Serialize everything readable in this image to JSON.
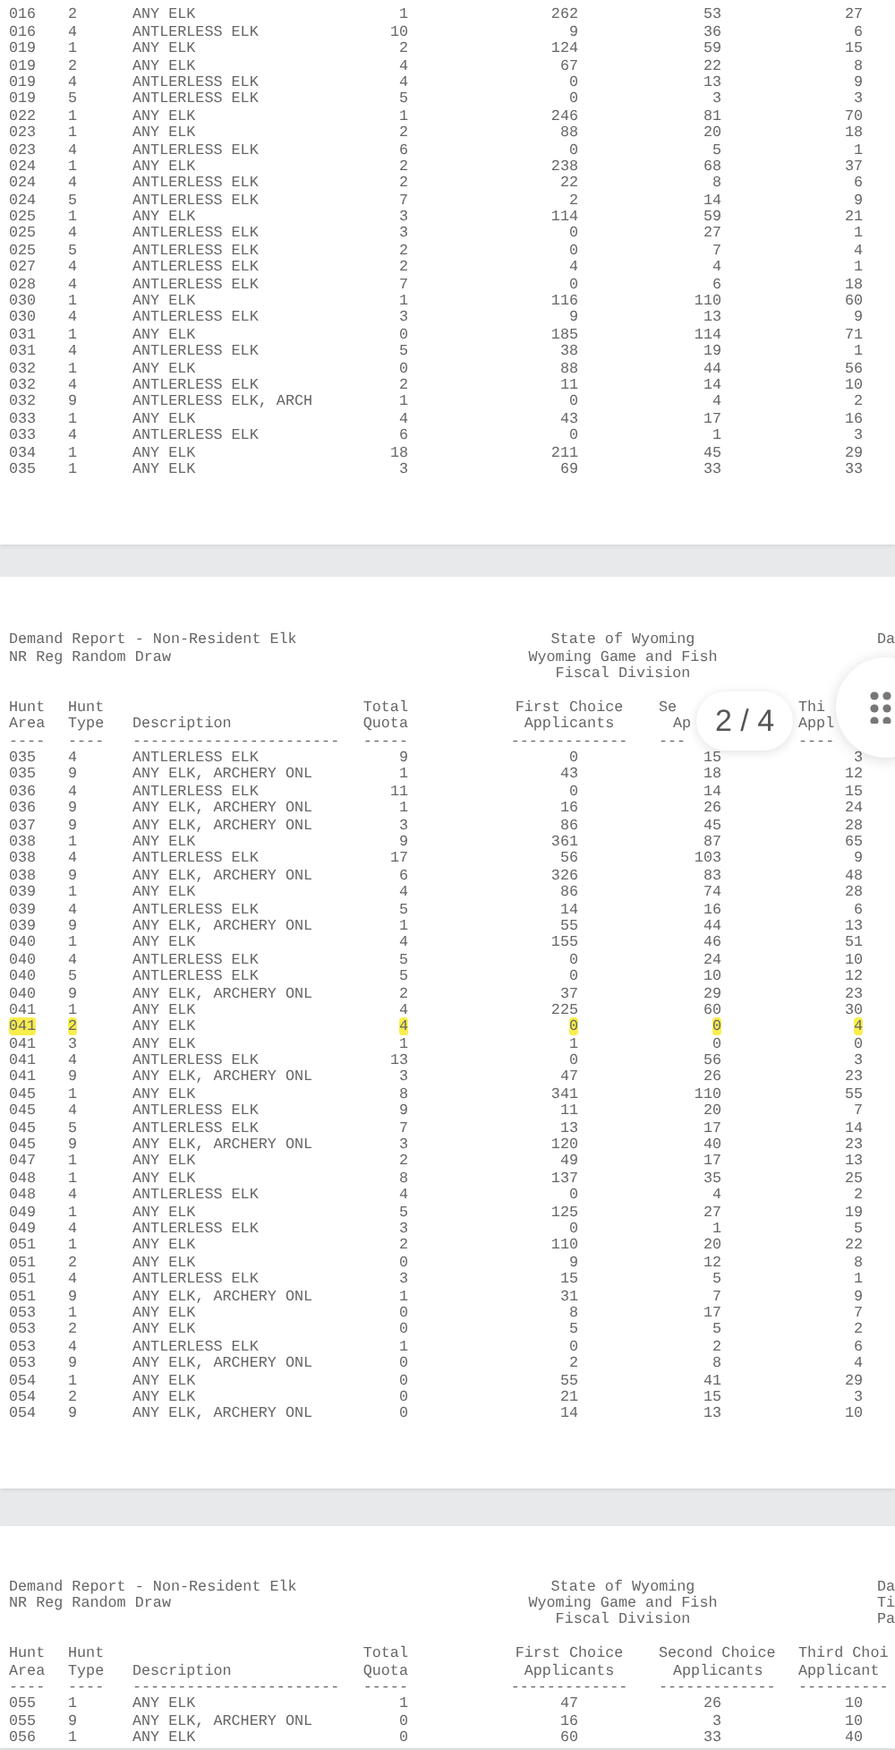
{
  "pages": [
    {
      "rows": [
        {
          "cells": [
            "016",
            "2",
            "ANY ELK",
            "1",
            "262",
            "53",
            "27"
          ],
          "highlighted": false
        },
        {
          "cells": [
            "016",
            "4",
            "ANTLERLESS ELK",
            "10",
            "9",
            "36",
            "6"
          ],
          "highlighted": false
        },
        {
          "cells": [
            "019",
            "1",
            "ANY ELK",
            "2",
            "124",
            "59",
            "15"
          ],
          "highlighted": false
        },
        {
          "cells": [
            "019",
            "2",
            "ANY ELK",
            "4",
            "67",
            "22",
            "8"
          ],
          "highlighted": false
        },
        {
          "cells": [
            "019",
            "4",
            "ANTLERLESS ELK",
            "4",
            "0",
            "13",
            "9"
          ],
          "highlighted": false
        },
        {
          "cells": [
            "019",
            "5",
            "ANTLERLESS ELK",
            "5",
            "0",
            "3",
            "3"
          ],
          "highlighted": false
        },
        {
          "cells": [
            "022",
            "1",
            "ANY ELK",
            "1",
            "246",
            "81",
            "70"
          ],
          "highlighted": false
        },
        {
          "cells": [
            "023",
            "1",
            "ANY ELK",
            "2",
            "88",
            "20",
            "18"
          ],
          "highlighted": false
        },
        {
          "cells": [
            "023",
            "4",
            "ANTLERLESS ELK",
            "6",
            "0",
            "5",
            "1"
          ],
          "highlighted": false
        },
        {
          "cells": [
            "024",
            "1",
            "ANY ELK",
            "2",
            "238",
            "68",
            "37"
          ],
          "highlighted": false
        },
        {
          "cells": [
            "024",
            "4",
            "ANTLERLESS ELK",
            "2",
            "22",
            "8",
            "6"
          ],
          "highlighted": false
        },
        {
          "cells": [
            "024",
            "5",
            "ANTLERLESS ELK",
            "7",
            "2",
            "14",
            "9"
          ],
          "highlighted": false
        },
        {
          "cells": [
            "025",
            "1",
            "ANY ELK",
            "3",
            "114",
            "59",
            "21"
          ],
          "highlighted": false
        },
        {
          "cells": [
            "025",
            "4",
            "ANTLERLESS ELK",
            "3",
            "0",
            "27",
            "1"
          ],
          "highlighted": false
        },
        {
          "cells": [
            "025",
            "5",
            "ANTLERLESS ELK",
            "2",
            "0",
            "7",
            "4"
          ],
          "highlighted": false
        },
        {
          "cells": [
            "027",
            "4",
            "ANTLERLESS ELK",
            "2",
            "4",
            "4",
            "1"
          ],
          "highlighted": false
        },
        {
          "cells": [
            "028",
            "4",
            "ANTLERLESS ELK",
            "7",
            "0",
            "6",
            "18"
          ],
          "highlighted": false
        },
        {
          "cells": [
            "030",
            "1",
            "ANY ELK",
            "1",
            "116",
            "110",
            "60"
          ],
          "highlighted": false
        },
        {
          "cells": [
            "030",
            "4",
            "ANTLERLESS ELK",
            "3",
            "9",
            "13",
            "9"
          ],
          "highlighted": false
        },
        {
          "cells": [
            "031",
            "1",
            "ANY ELK",
            "0",
            "185",
            "114",
            "71"
          ],
          "highlighted": false
        },
        {
          "cells": [
            "031",
            "4",
            "ANTLERLESS ELK",
            "5",
            "38",
            "19",
            "1"
          ],
          "highlighted": false
        },
        {
          "cells": [
            "032",
            "1",
            "ANY ELK",
            "0",
            "88",
            "44",
            "56"
          ],
          "highlighted": false
        },
        {
          "cells": [
            "032",
            "4",
            "ANTLERLESS ELK",
            "2",
            "11",
            "14",
            "10"
          ],
          "highlighted": false
        },
        {
          "cells": [
            "032",
            "9",
            "ANTLERLESS ELK, ARCH",
            "1",
            "0",
            "4",
            "2"
          ],
          "highlighted": false
        },
        {
          "cells": [
            "033",
            "1",
            "ANY ELK",
            "4",
            "43",
            "17",
            "16"
          ],
          "highlighted": false
        },
        {
          "cells": [
            "033",
            "4",
            "ANTLERLESS ELK",
            "6",
            "0",
            "1",
            "3"
          ],
          "highlighted": false
        },
        {
          "cells": [
            "034",
            "1",
            "ANY ELK",
            "18",
            "211",
            "45",
            "29"
          ],
          "highlighted": false
        },
        {
          "cells": [
            "035",
            "1",
            "ANY ELK",
            "3",
            "69",
            "33",
            "33"
          ],
          "highlighted": false
        }
      ]
    },
    {
      "header": {
        "left": [
          "Demand Report - Non-Resident Elk",
          "NR Reg Random Draw"
        ],
        "center": [
          "State of Wyoming",
          "Wyoming Game and Fish",
          "Fiscal Division"
        ],
        "right": [
          "Da"
        ]
      },
      "columns": [
        {
          "line1": "Hunt",
          "line2": "Area",
          "rule": "----"
        },
        {
          "line1": "Hunt",
          "line2": "Type",
          "rule": "----"
        },
        {
          "line2": "Description",
          "rule": "-----------------------"
        },
        {
          "line1": "Total",
          "line2": "Quota",
          "rule": "-----"
        },
        {
          "line1": "First Choice",
          "line2": "Applicants",
          "rule": "-------------"
        },
        {
          "line1": "Se",
          "line2": "Ap",
          "rule": "---"
        },
        {
          "line1": "Thi",
          "line2": "Appl",
          "rule": "----"
        }
      ],
      "rows": [
        {
          "cells": [
            "035",
            "4",
            "ANTLERLESS ELK",
            "9",
            "0",
            "15",
            "3"
          ],
          "highlighted": false
        },
        {
          "cells": [
            "035",
            "9",
            "ANY ELK, ARCHERY ONL",
            "1",
            "43",
            "18",
            "12"
          ],
          "highlighted": false
        },
        {
          "cells": [
            "036",
            "4",
            "ANTLERLESS ELK",
            "11",
            "0",
            "14",
            "15"
          ],
          "highlighted": false
        },
        {
          "cells": [
            "036",
            "9",
            "ANY ELK, ARCHERY ONL",
            "1",
            "16",
            "26",
            "24"
          ],
          "highlighted": false
        },
        {
          "cells": [
            "037",
            "9",
            "ANY ELK, ARCHERY ONL",
            "3",
            "86",
            "45",
            "28"
          ],
          "highlighted": false
        },
        {
          "cells": [
            "038",
            "1",
            "ANY ELK",
            "9",
            "361",
            "87",
            "65"
          ],
          "highlighted": false
        },
        {
          "cells": [
            "038",
            "4",
            "ANTLERLESS ELK",
            "17",
            "56",
            "103",
            "9"
          ],
          "highlighted": false
        },
        {
          "cells": [
            "038",
            "9",
            "ANY ELK, ARCHERY ONL",
            "6",
            "326",
            "83",
            "48"
          ],
          "highlighted": false
        },
        {
          "cells": [
            "039",
            "1",
            "ANY ELK",
            "4",
            "86",
            "74",
            "28"
          ],
          "highlighted": false
        },
        {
          "cells": [
            "039",
            "4",
            "ANTLERLESS ELK",
            "5",
            "14",
            "16",
            "6"
          ],
          "highlighted": false
        },
        {
          "cells": [
            "039",
            "9",
            "ANY ELK, ARCHERY ONL",
            "1",
            "55",
            "44",
            "13"
          ],
          "highlighted": false
        },
        {
          "cells": [
            "040",
            "1",
            "ANY ELK",
            "4",
            "155",
            "46",
            "51"
          ],
          "highlighted": false
        },
        {
          "cells": [
            "040",
            "4",
            "ANTLERLESS ELK",
            "5",
            "0",
            "24",
            "10"
          ],
          "highlighted": false
        },
        {
          "cells": [
            "040",
            "5",
            "ANTLERLESS ELK",
            "5",
            "0",
            "10",
            "12"
          ],
          "highlighted": false
        },
        {
          "cells": [
            "040",
            "9",
            "ANY ELK, ARCHERY ONL",
            "2",
            "37",
            "29",
            "23"
          ],
          "highlighted": false
        },
        {
          "cells": [
            "041",
            "1",
            "ANY ELK",
            "4",
            "225",
            "60",
            "30"
          ],
          "highlighted": false
        },
        {
          "cells": [
            "041",
            "2",
            "ANY ELK",
            "4",
            "0",
            "0",
            "4"
          ],
          "highlighted": true
        },
        {
          "cells": [
            "041",
            "3",
            "ANY ELK",
            "1",
            "1",
            "0",
            "0"
          ],
          "highlighted": false
        },
        {
          "cells": [
            "041",
            "4",
            "ANTLERLESS ELK",
            "13",
            "0",
            "56",
            "3"
          ],
          "highlighted": false
        },
        {
          "cells": [
            "041",
            "9",
            "ANY ELK, ARCHERY ONL",
            "3",
            "47",
            "26",
            "23"
          ],
          "highlighted": false
        },
        {
          "cells": [
            "045",
            "1",
            "ANY ELK",
            "8",
            "341",
            "110",
            "55"
          ],
          "highlighted": false
        },
        {
          "cells": [
            "045",
            "4",
            "ANTLERLESS ELK",
            "9",
            "11",
            "20",
            "7"
          ],
          "highlighted": false
        },
        {
          "cells": [
            "045",
            "5",
            "ANTLERLESS ELK",
            "7",
            "13",
            "17",
            "14"
          ],
          "highlighted": false
        },
        {
          "cells": [
            "045",
            "9",
            "ANY ELK, ARCHERY ONL",
            "3",
            "120",
            "40",
            "23"
          ],
          "highlighted": false
        },
        {
          "cells": [
            "047",
            "1",
            "ANY ELK",
            "2",
            "49",
            "17",
            "13"
          ],
          "highlighted": false
        },
        {
          "cells": [
            "048",
            "1",
            "ANY ELK",
            "8",
            "137",
            "35",
            "25"
          ],
          "highlighted": false
        },
        {
          "cells": [
            "048",
            "4",
            "ANTLERLESS ELK",
            "4",
            "0",
            "4",
            "2"
          ],
          "highlighted": false
        },
        {
          "cells": [
            "049",
            "1",
            "ANY ELK",
            "5",
            "125",
            "27",
            "19"
          ],
          "highlighted": false
        },
        {
          "cells": [
            "049",
            "4",
            "ANTLERLESS ELK",
            "3",
            "0",
            "1",
            "5"
          ],
          "highlighted": false
        },
        {
          "cells": [
            "051",
            "1",
            "ANY ELK",
            "2",
            "110",
            "20",
            "22"
          ],
          "highlighted": false
        },
        {
          "cells": [
            "051",
            "2",
            "ANY ELK",
            "0",
            "9",
            "12",
            "8"
          ],
          "highlighted": false
        },
        {
          "cells": [
            "051",
            "4",
            "ANTLERLESS ELK",
            "3",
            "15",
            "5",
            "1"
          ],
          "highlighted": false
        },
        {
          "cells": [
            "051",
            "9",
            "ANY ELK, ARCHERY ONL",
            "1",
            "31",
            "7",
            "9"
          ],
          "highlighted": false
        },
        {
          "cells": [
            "053",
            "1",
            "ANY ELK",
            "0",
            "8",
            "17",
            "7"
          ],
          "highlighted": false
        },
        {
          "cells": [
            "053",
            "2",
            "ANY ELK",
            "0",
            "5",
            "5",
            "2"
          ],
          "highlighted": false
        },
        {
          "cells": [
            "053",
            "4",
            "ANTLERLESS ELK",
            "1",
            "0",
            "2",
            "6"
          ],
          "highlighted": false
        },
        {
          "cells": [
            "053",
            "9",
            "ANY ELK, ARCHERY ONL",
            "0",
            "2",
            "8",
            "4"
          ],
          "highlighted": false
        },
        {
          "cells": [
            "054",
            "1",
            "ANY ELK",
            "0",
            "55",
            "41",
            "29"
          ],
          "highlighted": false
        },
        {
          "cells": [
            "054",
            "2",
            "ANY ELK",
            "0",
            "21",
            "15",
            "3"
          ],
          "highlighted": false
        },
        {
          "cells": [
            "054",
            "9",
            "ANY ELK, ARCHERY ONL",
            "0",
            "14",
            "13",
            "10"
          ],
          "highlighted": false
        }
      ]
    },
    {
      "header": {
        "left": [
          "Demand Report - Non-Resident Elk",
          "NR Reg Random Draw"
        ],
        "center": [
          "State of Wyoming",
          "Wyoming Game and Fish",
          "Fiscal Division"
        ],
        "right": [
          "Da",
          "Ti",
          "Pa"
        ]
      },
      "columns": [
        {
          "line1": "Hunt",
          "line2": "Area",
          "rule": "----"
        },
        {
          "line1": "Hunt",
          "line2": "Type",
          "rule": "----"
        },
        {
          "line2": "Description",
          "rule": "-----------------------"
        },
        {
          "line1": "Total",
          "line2": "Quota",
          "rule": "-----"
        },
        {
          "line1": "First Choice",
          "line2": "Applicants",
          "rule": "-------------"
        },
        {
          "line1": "Second Choice",
          "line2": "Applicants",
          "rule": "-------------"
        },
        {
          "line1": "Third Choi",
          "line2": "Applicant",
          "rule": "----------"
        }
      ],
      "rows": [
        {
          "cells": [
            "055",
            "1",
            "ANY ELK",
            "1",
            "47",
            "26",
            "10"
          ],
          "highlighted": false
        },
        {
          "cells": [
            "055",
            "9",
            "ANY ELK, ARCHERY ONL",
            "0",
            "16",
            "3",
            "10"
          ],
          "highlighted": false
        },
        {
          "cells": [
            "056",
            "1",
            "ANY ELK",
            "0",
            "60",
            "33",
            "40"
          ],
          "highlighted": false
        }
      ]
    }
  ],
  "page_indicator": "2 / 4"
}
